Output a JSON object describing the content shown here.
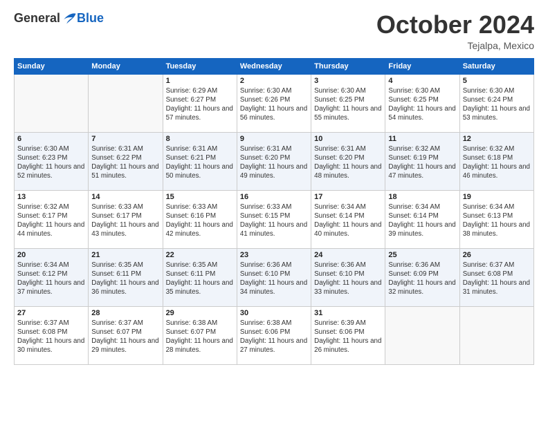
{
  "header": {
    "logo_general": "General",
    "logo_blue": "Blue",
    "month_title": "October 2024",
    "location": "Tejalpa, Mexico"
  },
  "weekdays": [
    "Sunday",
    "Monday",
    "Tuesday",
    "Wednesday",
    "Thursday",
    "Friday",
    "Saturday"
  ],
  "weeks": [
    [
      {
        "day": "",
        "info": ""
      },
      {
        "day": "",
        "info": ""
      },
      {
        "day": "1",
        "info": "Sunrise: 6:29 AM\nSunset: 6:27 PM\nDaylight: 11 hours and 57 minutes."
      },
      {
        "day": "2",
        "info": "Sunrise: 6:30 AM\nSunset: 6:26 PM\nDaylight: 11 hours and 56 minutes."
      },
      {
        "day": "3",
        "info": "Sunrise: 6:30 AM\nSunset: 6:25 PM\nDaylight: 11 hours and 55 minutes."
      },
      {
        "day": "4",
        "info": "Sunrise: 6:30 AM\nSunset: 6:25 PM\nDaylight: 11 hours and 54 minutes."
      },
      {
        "day": "5",
        "info": "Sunrise: 6:30 AM\nSunset: 6:24 PM\nDaylight: 11 hours and 53 minutes."
      }
    ],
    [
      {
        "day": "6",
        "info": "Sunrise: 6:30 AM\nSunset: 6:23 PM\nDaylight: 11 hours and 52 minutes."
      },
      {
        "day": "7",
        "info": "Sunrise: 6:31 AM\nSunset: 6:22 PM\nDaylight: 11 hours and 51 minutes."
      },
      {
        "day": "8",
        "info": "Sunrise: 6:31 AM\nSunset: 6:21 PM\nDaylight: 11 hours and 50 minutes."
      },
      {
        "day": "9",
        "info": "Sunrise: 6:31 AM\nSunset: 6:20 PM\nDaylight: 11 hours and 49 minutes."
      },
      {
        "day": "10",
        "info": "Sunrise: 6:31 AM\nSunset: 6:20 PM\nDaylight: 11 hours and 48 minutes."
      },
      {
        "day": "11",
        "info": "Sunrise: 6:32 AM\nSunset: 6:19 PM\nDaylight: 11 hours and 47 minutes."
      },
      {
        "day": "12",
        "info": "Sunrise: 6:32 AM\nSunset: 6:18 PM\nDaylight: 11 hours and 46 minutes."
      }
    ],
    [
      {
        "day": "13",
        "info": "Sunrise: 6:32 AM\nSunset: 6:17 PM\nDaylight: 11 hours and 44 minutes."
      },
      {
        "day": "14",
        "info": "Sunrise: 6:33 AM\nSunset: 6:17 PM\nDaylight: 11 hours and 43 minutes."
      },
      {
        "day": "15",
        "info": "Sunrise: 6:33 AM\nSunset: 6:16 PM\nDaylight: 11 hours and 42 minutes."
      },
      {
        "day": "16",
        "info": "Sunrise: 6:33 AM\nSunset: 6:15 PM\nDaylight: 11 hours and 41 minutes."
      },
      {
        "day": "17",
        "info": "Sunrise: 6:34 AM\nSunset: 6:14 PM\nDaylight: 11 hours and 40 minutes."
      },
      {
        "day": "18",
        "info": "Sunrise: 6:34 AM\nSunset: 6:14 PM\nDaylight: 11 hours and 39 minutes."
      },
      {
        "day": "19",
        "info": "Sunrise: 6:34 AM\nSunset: 6:13 PM\nDaylight: 11 hours and 38 minutes."
      }
    ],
    [
      {
        "day": "20",
        "info": "Sunrise: 6:34 AM\nSunset: 6:12 PM\nDaylight: 11 hours and 37 minutes."
      },
      {
        "day": "21",
        "info": "Sunrise: 6:35 AM\nSunset: 6:11 PM\nDaylight: 11 hours and 36 minutes."
      },
      {
        "day": "22",
        "info": "Sunrise: 6:35 AM\nSunset: 6:11 PM\nDaylight: 11 hours and 35 minutes."
      },
      {
        "day": "23",
        "info": "Sunrise: 6:36 AM\nSunset: 6:10 PM\nDaylight: 11 hours and 34 minutes."
      },
      {
        "day": "24",
        "info": "Sunrise: 6:36 AM\nSunset: 6:10 PM\nDaylight: 11 hours and 33 minutes."
      },
      {
        "day": "25",
        "info": "Sunrise: 6:36 AM\nSunset: 6:09 PM\nDaylight: 11 hours and 32 minutes."
      },
      {
        "day": "26",
        "info": "Sunrise: 6:37 AM\nSunset: 6:08 PM\nDaylight: 11 hours and 31 minutes."
      }
    ],
    [
      {
        "day": "27",
        "info": "Sunrise: 6:37 AM\nSunset: 6:08 PM\nDaylight: 11 hours and 30 minutes."
      },
      {
        "day": "28",
        "info": "Sunrise: 6:37 AM\nSunset: 6:07 PM\nDaylight: 11 hours and 29 minutes."
      },
      {
        "day": "29",
        "info": "Sunrise: 6:38 AM\nSunset: 6:07 PM\nDaylight: 11 hours and 28 minutes."
      },
      {
        "day": "30",
        "info": "Sunrise: 6:38 AM\nSunset: 6:06 PM\nDaylight: 11 hours and 27 minutes."
      },
      {
        "day": "31",
        "info": "Sunrise: 6:39 AM\nSunset: 6:06 PM\nDaylight: 11 hours and 26 minutes."
      },
      {
        "day": "",
        "info": ""
      },
      {
        "day": "",
        "info": ""
      }
    ]
  ]
}
